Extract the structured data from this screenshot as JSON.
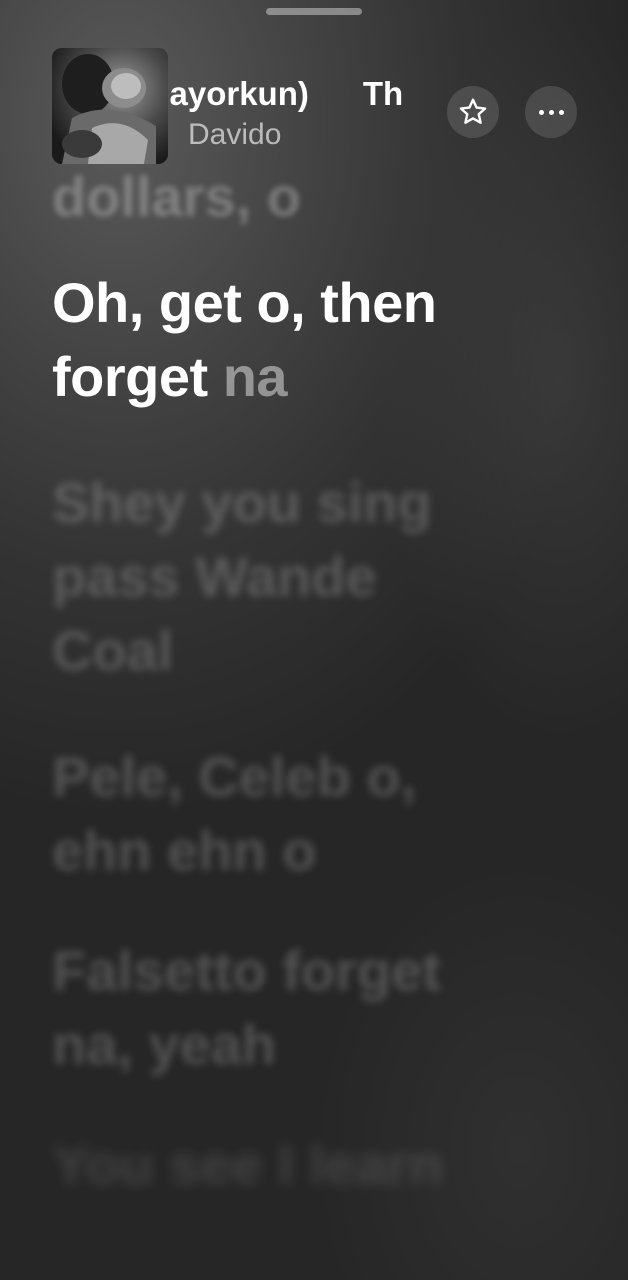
{
  "header": {
    "title_marquee": [
      "Mayorkun)",
      "Th"
    ],
    "artist": "Davido",
    "artwork_icon": "album-art-image"
  },
  "controls": {
    "favorite_icon": "star-icon",
    "more_icon": "ellipsis-icon"
  },
  "lyrics": {
    "previous_line": "dollars, o",
    "current_sung": "Oh, get o, then forget",
    "current_pending": "na",
    "upcoming": [
      "Shey you sing pass Wande Coal",
      "Pele, Celeb o, ehn ehn o",
      "Falsetto forget na, yeah",
      "You see I learn"
    ]
  }
}
